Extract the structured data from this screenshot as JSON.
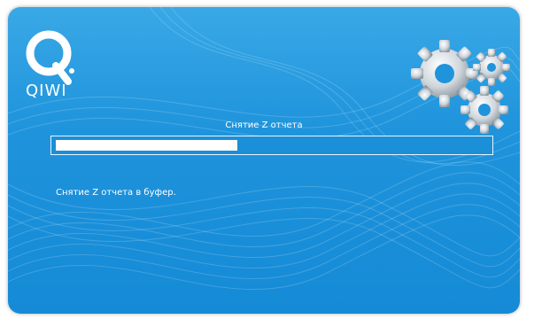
{
  "app": {
    "brand": "QIWI",
    "accent_color": "#1f94dc",
    "logo_icon": "qiwi-logo-icon",
    "decor_icon": "gears-icon"
  },
  "dialog": {
    "title": "Снятие Z отчета",
    "progress": 0.42,
    "status_text": "Снятие Z отчета в буфер."
  }
}
